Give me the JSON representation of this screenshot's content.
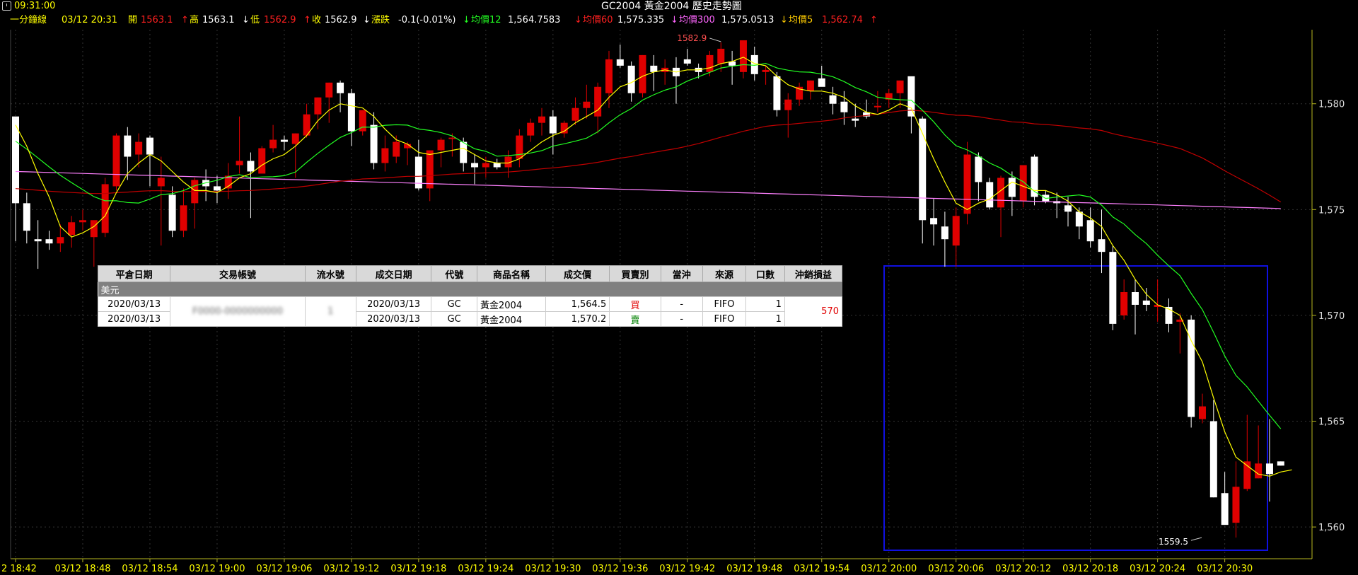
{
  "header": {
    "time": "09:31:00",
    "title": "GC2004 黃金2004  歷史走勢圖"
  },
  "info": {
    "interval_label": "一分鐘線",
    "datetime": "03/12 20:31",
    "open_label": "開",
    "open_value": "1563.1",
    "high_label": "高",
    "high_value": "1563.1",
    "low_label": "低",
    "low_value": "1562.9",
    "close_label": "收",
    "close_value": "1562.9",
    "change_label": "漲跌",
    "change_value": "-0.1(-0.01%)",
    "ma12_label": "均價12",
    "ma12_value": "1,564.7583",
    "ma60_label": "均價60",
    "ma60_value": "1,575.335",
    "ma300_label": "均價300",
    "ma300_value": "1,575.0513",
    "ma5_label": "均價5",
    "ma5_value": "1,562.74",
    "arrow_up": "↑",
    "arrow_down": "↓"
  },
  "colors": {
    "up_candle": "#e00000",
    "down_candle": "#ffffff",
    "ma5": "#ffff00",
    "ma12": "#22ff22",
    "ma60": "#c00000",
    "ma300": "#ff80ff",
    "grid": "#333333",
    "axis": "#b8b820",
    "selection": "#1010e0"
  },
  "chart_data": {
    "type": "candlestick",
    "ylim": [
      1558.5,
      1583.5
    ],
    "y_ticks": [
      "1,560",
      "1,565",
      "1,570",
      "1,575",
      "1,580"
    ],
    "y_tick_values": [
      1560,
      1565,
      1570,
      1575,
      1580
    ],
    "x_ticks": [
      "2 18:42",
      "03/12 18:48",
      "03/12 18:54",
      "03/12 19:00",
      "03/12 19:06",
      "03/12 19:12",
      "03/12 19:18",
      "03/12 19:24",
      "03/12 19:30",
      "03/12 19:36",
      "03/12 19:42",
      "03/12 19:48",
      "03/12 19:54",
      "03/12 20:00",
      "03/12 20:06",
      "03/12 20:12",
      "03/12 20:18",
      "03/12 20:24",
      "03/12 20:30"
    ],
    "x_tick_bar_index": [
      0,
      6,
      12,
      18,
      24,
      30,
      36,
      42,
      48,
      54,
      60,
      66,
      72,
      78,
      84,
      90,
      96,
      102,
      108
    ],
    "high_annotation": "1582.9",
    "high_annotation_bar": 63,
    "high_annotation_value": 1582.9,
    "low_annotation": "1559.5",
    "low_annotation_bar": 106,
    "low_annotation_value": 1559.5,
    "candles": [
      [
        1579.4,
        1579.0,
        1573.5,
        1575.3
      ],
      [
        1575.3,
        1575.8,
        1573.4,
        1574.0
      ],
      [
        1573.6,
        1574.5,
        1572.2,
        1573.5
      ],
      [
        1573.6,
        1574.0,
        1573.1,
        1573.4
      ],
      [
        1573.4,
        1574.3,
        1573.0,
        1573.7
      ],
      [
        1573.8,
        1574.7,
        1573.2,
        1574.4
      ],
      [
        1574.4,
        1575.0,
        1574.0,
        1574.5
      ],
      [
        1573.7,
        1574.2,
        1572.3,
        1574.5
      ],
      [
        1573.9,
        1576.5,
        1573.7,
        1576.2
      ],
      [
        1576.1,
        1578.6,
        1575.9,
        1578.5
      ],
      [
        1578.5,
        1578.9,
        1576.4,
        1577.5
      ],
      [
        1577.6,
        1578.6,
        1577.0,
        1578.2
      ],
      [
        1578.4,
        1578.5,
        1576.1,
        1577.6
      ],
      [
        1576.1,
        1577.5,
        1573.3,
        1576.5
      ],
      [
        1575.7,
        1576.1,
        1573.7,
        1574.0
      ],
      [
        1574.0,
        1576.0,
        1573.7,
        1575.2
      ],
      [
        1575.3,
        1576.5,
        1574.1,
        1576.4
      ],
      [
        1576.4,
        1576.9,
        1575.4,
        1576.1
      ],
      [
        1576.1,
        1576.6,
        1575.3,
        1575.9
      ],
      [
        1576.0,
        1577.2,
        1575.5,
        1576.6
      ],
      [
        1577.1,
        1579.4,
        1576.7,
        1577.3
      ],
      [
        1577.3,
        1577.7,
        1574.6,
        1576.8
      ],
      [
        1576.7,
        1578.0,
        1576.7,
        1577.9
      ],
      [
        1577.9,
        1579.0,
        1577.7,
        1578.3
      ],
      [
        1578.3,
        1578.5,
        1577.8,
        1578.2
      ],
      [
        1578.1,
        1578.6,
        1576.5,
        1578.6
      ],
      [
        1578.5,
        1580.0,
        1578.4,
        1579.5
      ],
      [
        1579.5,
        1580.3,
        1578.8,
        1580.3
      ],
      [
        1580.3,
        1581.0,
        1579.1,
        1581.0
      ],
      [
        1581.0,
        1581.1,
        1579.6,
        1580.5
      ],
      [
        1580.5,
        1580.7,
        1578.0,
        1578.7
      ],
      [
        1578.7,
        1579.7,
        1578.5,
        1579.7
      ],
      [
        1579.0,
        1579.6,
        1576.9,
        1577.2
      ],
      [
        1577.2,
        1578.5,
        1576.8,
        1577.9
      ],
      [
        1577.5,
        1578.5,
        1577.2,
        1578.2
      ],
      [
        1577.9,
        1578.2,
        1577.1,
        1578.1
      ],
      [
        1577.5,
        1578.3,
        1575.9,
        1576.0
      ],
      [
        1576.0,
        1577.8,
        1575.4,
        1577.8
      ],
      [
        1577.8,
        1578.4,
        1577.0,
        1578.3
      ],
      [
        1578.4,
        1578.6,
        1577.5,
        1578.4
      ],
      [
        1578.2,
        1578.4,
        1576.8,
        1577.2
      ],
      [
        1577.2,
        1577.6,
        1576.2,
        1577.0
      ],
      [
        1577.0,
        1577.5,
        1576.5,
        1577.2
      ],
      [
        1577.2,
        1577.4,
        1576.9,
        1577.0
      ],
      [
        1577.0,
        1577.8,
        1576.5,
        1577.5
      ],
      [
        1577.4,
        1578.8,
        1577.0,
        1578.5
      ],
      [
        1578.5,
        1579.3,
        1578.2,
        1579.1
      ],
      [
        1579.1,
        1579.8,
        1578.5,
        1579.4
      ],
      [
        1579.4,
        1579.7,
        1577.6,
        1578.6
      ],
      [
        1578.6,
        1579.2,
        1578.4,
        1579.1
      ],
      [
        1579.2,
        1580.3,
        1579.0,
        1579.8
      ],
      [
        1579.8,
        1580.9,
        1579.3,
        1580.1
      ],
      [
        1579.4,
        1581.0,
        1578.6,
        1580.8
      ],
      [
        1580.5,
        1582.5,
        1579.8,
        1582.1
      ],
      [
        1582.1,
        1582.8,
        1581.7,
        1581.8
      ],
      [
        1581.8,
        1582.0,
        1580.1,
        1580.5
      ],
      [
        1580.5,
        1582.3,
        1580.3,
        1582.3
      ],
      [
        1581.8,
        1582.3,
        1580.6,
        1581.5
      ],
      [
        1581.5,
        1582.1,
        1580.9,
        1581.7
      ],
      [
        1581.7,
        1582.2,
        1580.0,
        1581.3
      ],
      [
        1582.1,
        1582.6,
        1581.8,
        1581.9
      ],
      [
        1581.7,
        1581.9,
        1581.2,
        1581.5
      ],
      [
        1581.5,
        1582.5,
        1581.3,
        1582.3
      ],
      [
        1581.9,
        1582.9,
        1581.5,
        1582.6
      ],
      [
        1582.0,
        1582.5,
        1580.9,
        1581.8
      ],
      [
        1581.5,
        1583.0,
        1581.2,
        1583.0
      ],
      [
        1582.3,
        1582.7,
        1581.1,
        1581.4
      ],
      [
        1581.5,
        1581.8,
        1580.9,
        1581.6
      ],
      [
        1581.3,
        1581.5,
        1579.4,
        1579.7
      ],
      [
        1579.7,
        1580.5,
        1578.4,
        1580.2
      ],
      [
        1580.2,
        1581.0,
        1579.9,
        1580.8
      ],
      [
        1580.6,
        1581.1,
        1580.2,
        1581.1
      ],
      [
        1581.2,
        1581.8,
        1580.9,
        1580.8
      ],
      [
        1580.4,
        1580.8,
        1579.5,
        1580.0
      ],
      [
        1580.1,
        1580.6,
        1579.0,
        1579.6
      ],
      [
        1579.3,
        1580.0,
        1578.9,
        1579.2
      ],
      [
        1579.6,
        1580.2,
        1579.3,
        1579.4
      ],
      [
        1579.9,
        1580.6,
        1579.6,
        1579.9
      ],
      [
        1580.2,
        1580.7,
        1579.8,
        1580.5
      ],
      [
        1580.5,
        1581.1,
        1579.8,
        1581.1
      ],
      [
        1581.3,
        1580.9,
        1578.6,
        1579.4
      ],
      [
        1579.3,
        1579.4,
        1573.4,
        1574.5
      ],
      [
        1574.6,
        1575.5,
        1573.3,
        1574.3
      ],
      [
        1574.2,
        1574.9,
        1572.3,
        1573.6
      ],
      [
        1573.3,
        1575.1,
        1572.3,
        1574.7
      ],
      [
        1574.8,
        1578.2,
        1574.3,
        1577.6
      ],
      [
        1577.5,
        1577.7,
        1575.4,
        1576.3
      ],
      [
        1576.3,
        1576.5,
        1575.0,
        1575.1
      ],
      [
        1575.1,
        1576.6,
        1573.7,
        1576.5
      ],
      [
        1576.5,
        1576.8,
        1574.7,
        1575.6
      ],
      [
        1575.4,
        1577.0,
        1575.1,
        1577.1
      ],
      [
        1577.5,
        1577.6,
        1575.2,
        1575.6
      ],
      [
        1575.7,
        1575.9,
        1575.3,
        1575.4
      ],
      [
        1575.4,
        1575.8,
        1574.6,
        1575.3
      ],
      [
        1575.2,
        1575.6,
        1574.2,
        1574.9
      ],
      [
        1574.9,
        1575.1,
        1573.6,
        1574.2
      ],
      [
        1574.5,
        1575.1,
        1573.2,
        1573.5
      ],
      [
        1573.6,
        1575.0,
        1572.0,
        1573.0
      ],
      [
        1573.0,
        1573.3,
        1569.3,
        1569.6
      ],
      [
        1570.0,
        1571.7,
        1569.8,
        1571.1
      ],
      [
        1571.1,
        1571.7,
        1569.1,
        1570.5
      ],
      [
        1570.7,
        1571.3,
        1570.2,
        1570.5
      ],
      [
        1570.4,
        1571.7,
        1569.7,
        1570.5
      ],
      [
        1570.4,
        1570.8,
        1569.2,
        1569.6
      ],
      [
        1569.7,
        1570.1,
        1568.2,
        1569.8
      ],
      [
        1569.8,
        1570.0,
        1564.7,
        1565.2
      ],
      [
        1565.1,
        1566.3,
        1564.9,
        1565.7
      ],
      [
        1565.0,
        1566.0,
        1561.4,
        1561.4
      ],
      [
        1561.6,
        1562.6,
        1560.1,
        1560.1
      ],
      [
        1560.2,
        1563.1,
        1559.5,
        1561.9
      ],
      [
        1561.8,
        1565.3,
        1561.7,
        1563.1
      ],
      [
        1562.3,
        1564.8,
        1562.3,
        1563.0
      ],
      [
        1563.0,
        1565.1,
        1561.2,
        1562.5
      ],
      [
        1563.1,
        1563.1,
        1562.9,
        1562.9
      ]
    ],
    "ma5": [
      1579.0,
      1578.0,
      1576.7,
      1575.6,
      1574.2,
      1573.7,
      1573.9,
      1574.2,
      1574.7,
      1575.8,
      1576.7,
      1577.2,
      1577.6,
      1577.3,
      1576.8,
      1576.3,
      1575.9,
      1575.9,
      1575.8,
      1576.1,
      1576.5,
      1576.7,
      1577.1,
      1577.4,
      1577.6,
      1578.0,
      1578.5,
      1579.2,
      1579.7,
      1580.0,
      1579.9,
      1579.8,
      1579.4,
      1578.8,
      1578.3,
      1578.1,
      1577.7,
      1577.6,
      1577.7,
      1577.8,
      1577.9,
      1577.6,
      1577.3,
      1577.2,
      1577.2,
      1577.4,
      1577.8,
      1578.2,
      1578.5,
      1578.7,
      1579.1,
      1579.4,
      1579.7,
      1580.3,
      1580.8,
      1581.0,
      1581.3,
      1581.5,
      1581.6,
      1581.5,
      1581.6,
      1581.6,
      1581.7,
      1581.9,
      1582.0,
      1582.2,
      1581.9,
      1581.8,
      1581.3,
      1580.9,
      1580.7,
      1580.6,
      1580.6,
      1580.5,
      1580.3,
      1579.9,
      1579.6,
      1579.5,
      1579.7,
      1580.0,
      1579.8,
      1578.6,
      1577.4,
      1576.3,
      1575.3,
      1575.0,
      1575.3,
      1575.5,
      1575.9,
      1576.3,
      1576.1,
      1575.9,
      1575.9,
      1575.7,
      1575.4,
      1574.9,
      1574.6,
      1574.2,
      1573.3,
      1572.6,
      1571.7,
      1571.0,
      1570.5,
      1570.3,
      1570.0,
      1568.8,
      1567.8,
      1566.1,
      1564.5,
      1563.3,
      1562.9,
      1562.5,
      1562.4,
      1562.6,
      1562.7
    ]
  },
  "table": {
    "headers": [
      "平倉日期",
      "交易帳號",
      "流水號",
      "成交日期",
      "代號",
      "商品名稱",
      "成交價",
      "買賣別",
      "當沖",
      "來源",
      "口數",
      "沖銷損益"
    ],
    "group": "美元",
    "rows": [
      {
        "close_date": "2020/03/13",
        "account": "F0000-0000000000",
        "serial": "1",
        "trade_date": "2020/03/13",
        "code": "GC",
        "name": "黃金2004",
        "price": "1,564.5",
        "side": "買",
        "daytrade": "-",
        "source": "FIFO",
        "qty": "1"
      },
      {
        "close_date": "2020/03/13",
        "account": "F0000-0000000000",
        "serial": "1",
        "trade_date": "2020/03/13",
        "code": "GC",
        "name": "黃金2004",
        "price": "1,570.2",
        "side": "賣",
        "daytrade": "-",
        "source": "FIFO",
        "qty": "1"
      }
    ],
    "pnl": "570"
  }
}
